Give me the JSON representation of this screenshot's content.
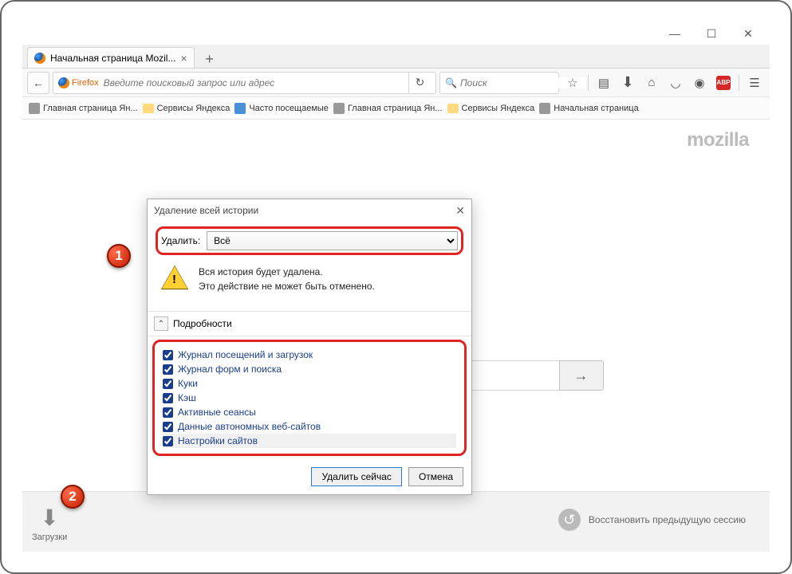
{
  "tab": {
    "title": "Начальная страница Mozil..."
  },
  "urlbar": {
    "prefix": "Firefox",
    "placeholder": "Введите поисковый запрос или адрес"
  },
  "searchbar": {
    "placeholder": "Поиск"
  },
  "bookmarks": [
    "Главная страница Ян...",
    "Сервисы Яндекса",
    "Часто посещаемые",
    "Главная страница Ян...",
    "Сервисы Яндекса",
    "Начальная страница"
  ],
  "brand": "mozilla",
  "downloads_label": "Загрузки",
  "restore_label": "Восстановить предыдущую сессию",
  "dialog": {
    "title": "Удаление всей истории",
    "delete_label": "Удалить:",
    "delete_value": "Всё",
    "warning_line1": "Вся история будет удалена.",
    "warning_line2": "Это действие не может быть отменено.",
    "details_label": "Подробности",
    "checkboxes": [
      "Журнал посещений и загрузок",
      "Журнал форм и поиска",
      "Куки",
      "Кэш",
      "Активные сеансы",
      "Данные автономных веб-сайтов",
      "Настройки сайтов"
    ],
    "delete_now": "Удалить сейчас",
    "cancel": "Отмена"
  },
  "markers": {
    "m1": "1",
    "m2": "2"
  }
}
